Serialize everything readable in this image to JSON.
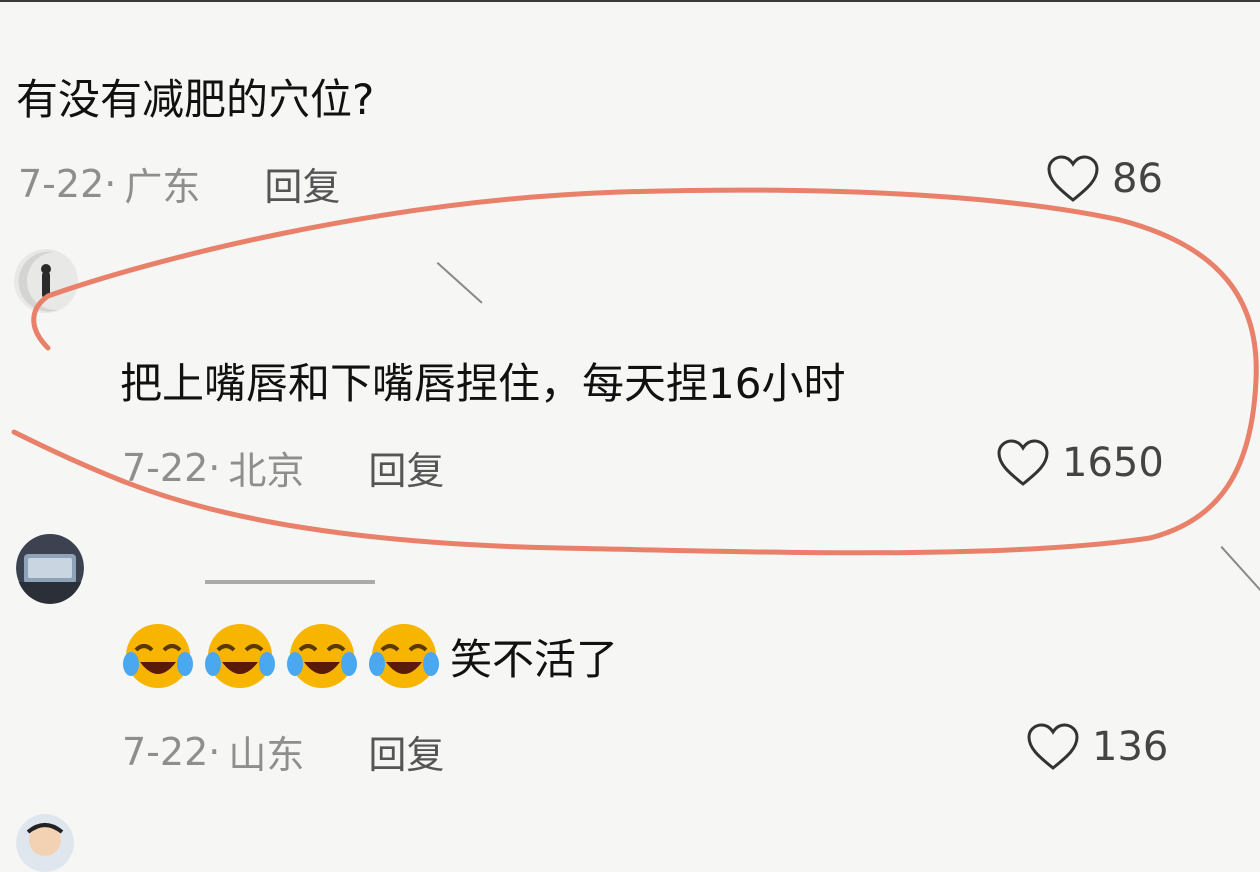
{
  "question": {
    "text": "有没有减肥的穴位?",
    "date": "7-22·",
    "location": "广东",
    "reply": "回复",
    "likes": "86"
  },
  "comment1": {
    "text": "把上嘴唇和下嘴唇捏住，每天捏16小时",
    "date": "7-22·",
    "location": "北京",
    "reply": "回复",
    "likes": "1650"
  },
  "comment2": {
    "emojis": [
      "crying-laughing-emoji",
      "crying-laughing-emoji",
      "crying-laughing-emoji",
      "crying-laughing-emoji"
    ],
    "text": "笑不活了",
    "date": "7-22·",
    "location": "山东",
    "reply": "回复",
    "likes": "136"
  },
  "icons": {
    "like": "heart-outline-icon"
  },
  "colors": {
    "background": "#f6f6f4",
    "annotation": "#e8806a",
    "meta_text": "#8e8e8e"
  }
}
